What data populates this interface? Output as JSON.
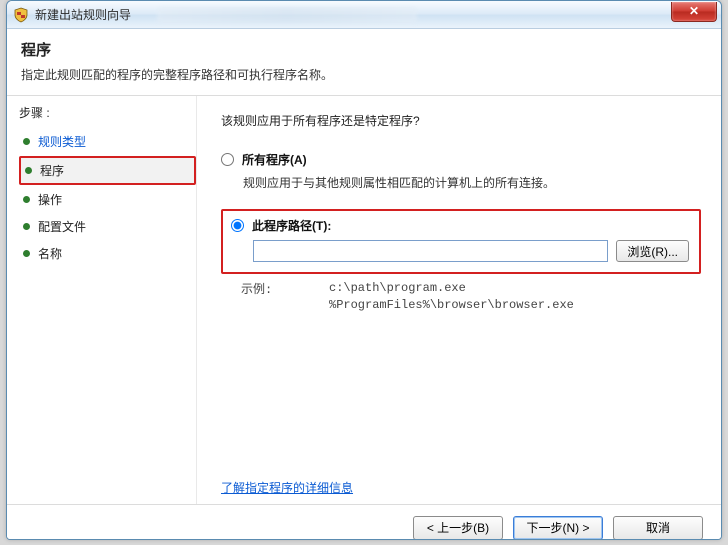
{
  "window": {
    "title": "新建出站规则向导"
  },
  "header": {
    "title": "程序",
    "subtitle": "指定此规则匹配的程序的完整程序路径和可执行程序名称。"
  },
  "sidebar": {
    "steps_label": "步骤 :",
    "items": [
      {
        "label": "规则类型"
      },
      {
        "label": "程序"
      },
      {
        "label": "操作"
      },
      {
        "label": "配置文件"
      },
      {
        "label": "名称"
      }
    ]
  },
  "main": {
    "question": "该规则应用于所有程序还是特定程序?",
    "option_all": {
      "label": "所有程序(A)",
      "desc": "规则应用于与其他规则属性相匹配的计算机上的所有连接。"
    },
    "option_path": {
      "label": "此程序路径(T):",
      "value": "",
      "browse": "浏览(R)..."
    },
    "example": {
      "label": "示例:",
      "body": "c:\\path\\program.exe\n%ProgramFiles%\\browser\\browser.exe"
    },
    "learn_more": "了解指定程序的详细信息"
  },
  "footer": {
    "back": "< 上一步(B)",
    "next": "下一步(N) >",
    "cancel": "取消"
  }
}
